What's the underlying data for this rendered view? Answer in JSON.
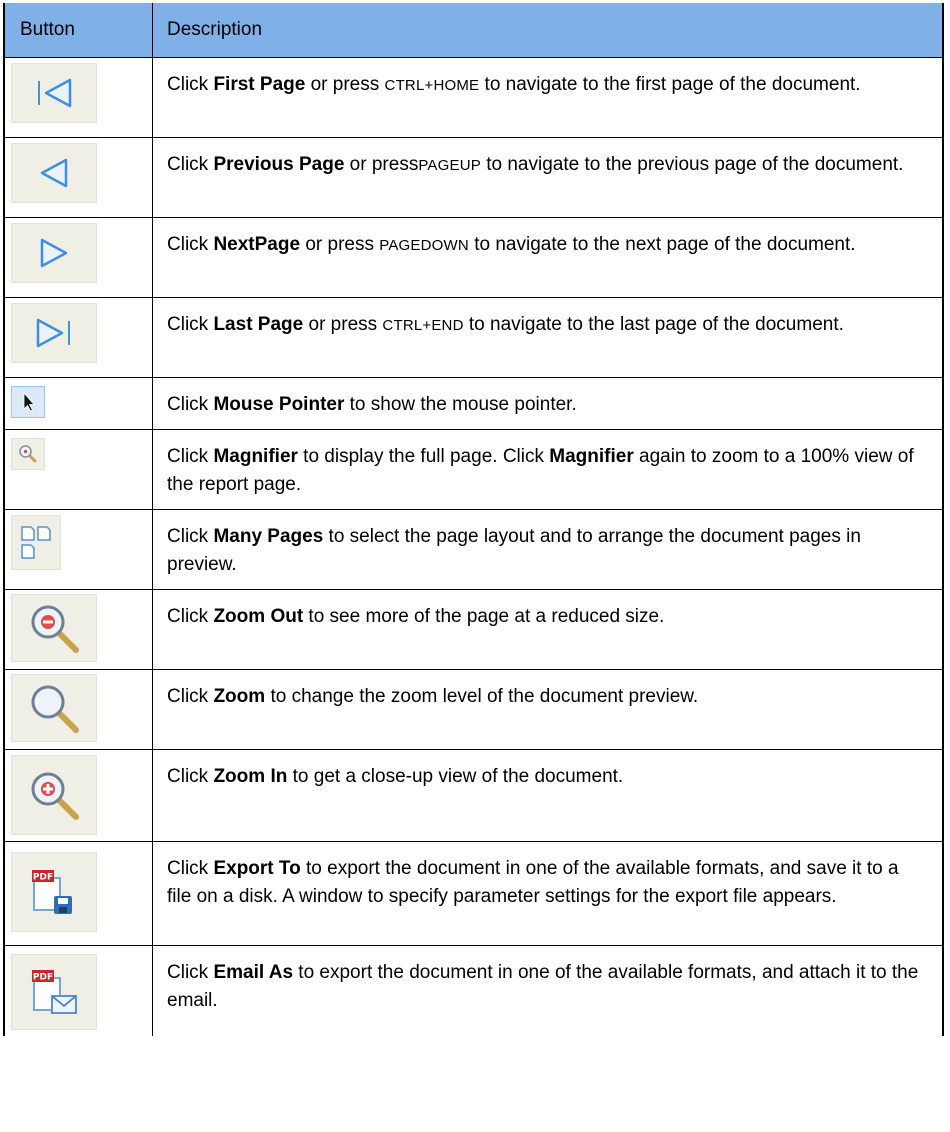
{
  "header": {
    "col1": "Button",
    "col2": "Description"
  },
  "rows": [
    {
      "icon": "first-page-icon",
      "parts": [
        "Click ",
        "First Page",
        " or press ",
        "CTRL+HOME",
        " to navigate to the first page of the document."
      ]
    },
    {
      "icon": "previous-page-icon",
      "parts": [
        "Click ",
        "Previous Page",
        " or press",
        "PAGEUP",
        " to navigate to the previous page of the document."
      ]
    },
    {
      "icon": "next-page-icon",
      "parts": [
        "Click ",
        "NextPage",
        " or press ",
        "PAGEDOWN",
        " to navigate to the next page of the document."
      ]
    },
    {
      "icon": "last-page-icon",
      "parts": [
        "Click ",
        "Last Page",
        " or press ",
        "CTRL+END",
        " to navigate to the last page of the document."
      ]
    },
    {
      "icon": "mouse-pointer-icon",
      "parts": [
        "Click ",
        "Mouse Pointer",
        " to show the mouse pointer."
      ]
    },
    {
      "icon": "magnifier-icon",
      "parts": [
        "Click ",
        "Magnifier",
        " to display the full page. Click ",
        "Magnifier",
        " again to zoom to a 100% view of the report page."
      ]
    },
    {
      "icon": "many-pages-icon",
      "parts": [
        "Click ",
        "Many Pages",
        " to select the page layout and to arrange the document pages in preview."
      ]
    },
    {
      "icon": "zoom-out-icon",
      "parts": [
        "Click ",
        "Zoom Out",
        " to see more of the page at a reduced size."
      ]
    },
    {
      "icon": "zoom-icon",
      "parts": [
        "Click ",
        "Zoom",
        " to change the zoom level of the document preview."
      ]
    },
    {
      "icon": "zoom-in-icon",
      "parts": [
        "Click ",
        "Zoom In",
        " to get a close-up view of the document."
      ]
    },
    {
      "icon": "export-to-icon",
      "parts": [
        "Click ",
        "Export To",
        " to export the document in one of the available formats, and save it to a file on a disk. A window to specify parameter settings for the export file appears."
      ]
    },
    {
      "icon": "email-as-icon",
      "parts": [
        "Click ",
        "Email As",
        " to export the document in one of the available formats, and attach it to the email."
      ]
    }
  ],
  "icon_labels": {
    "pdf": "PDF"
  },
  "colors": {
    "header_bg": "#7fb0e8",
    "icon_bg": "#efefe6",
    "nav_blue": "#3f8fe0"
  }
}
